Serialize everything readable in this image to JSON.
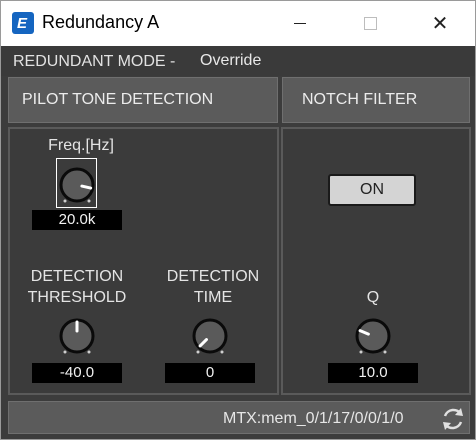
{
  "window": {
    "title": "Redundancy A",
    "icon_letter": "E",
    "minimize_icon": "minimize-icon",
    "maximize_icon": "maximize-icon",
    "close_glyph": "✕"
  },
  "mode": {
    "label": "REDUNDANT MODE -",
    "value": "Override"
  },
  "pilot_tone": {
    "header": "PILOT TONE DETECTION",
    "freq": {
      "label": "Freq.[Hz]",
      "value": "20.0k",
      "level": 0.88
    },
    "threshold": {
      "label_line1": "DETECTION",
      "label_line2": "THRESHOLD",
      "value": "-40.0",
      "level": 0.5
    },
    "time": {
      "label_line1": "DETECTION",
      "label_line2": "TIME",
      "value": "0",
      "level": 0.0
    }
  },
  "notch_filter": {
    "header": "NOTCH FILTER",
    "on_label": "ON",
    "q": {
      "label": "Q",
      "value": "10.0",
      "level": 0.25
    }
  },
  "status": {
    "text": "MTX:mem_0/1/17/0/0/1/0",
    "icon": "sync-icon"
  },
  "colors": {
    "background": "#3c3c3c",
    "panel_header": "#5b5b5b",
    "value_box": "#000000",
    "button": "#d4d4d4"
  }
}
